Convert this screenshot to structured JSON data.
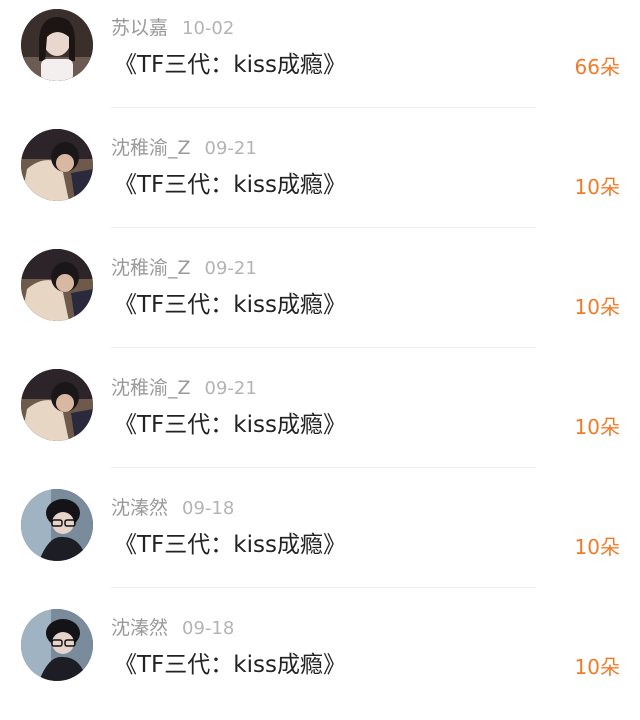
{
  "accent_color": "#f07c2a",
  "items": [
    {
      "name": "苏以嘉",
      "date": "10-02",
      "title": "《TF三代：kiss成瘾》",
      "count": "66朵",
      "avatar_icon": "user-avatar"
    },
    {
      "name": "沈稚渝_Z",
      "date": "09-21",
      "title": "《TF三代：kiss成瘾》",
      "count": "10朵",
      "avatar_icon": "user-avatar"
    },
    {
      "name": "沈稚渝_Z",
      "date": "09-21",
      "title": "《TF三代：kiss成瘾》",
      "count": "10朵",
      "avatar_icon": "user-avatar"
    },
    {
      "name": "沈稚渝_Z",
      "date": "09-21",
      "title": "《TF三代：kiss成瘾》",
      "count": "10朵",
      "avatar_icon": "user-avatar"
    },
    {
      "name": "沈溱然",
      "date": "09-18",
      "title": "《TF三代：kiss成瘾》",
      "count": "10朵",
      "avatar_icon": "user-avatar"
    },
    {
      "name": "沈溱然",
      "date": "09-18",
      "title": "《TF三代：kiss成瘾》",
      "count": "10朵",
      "avatar_icon": "user-avatar"
    }
  ]
}
